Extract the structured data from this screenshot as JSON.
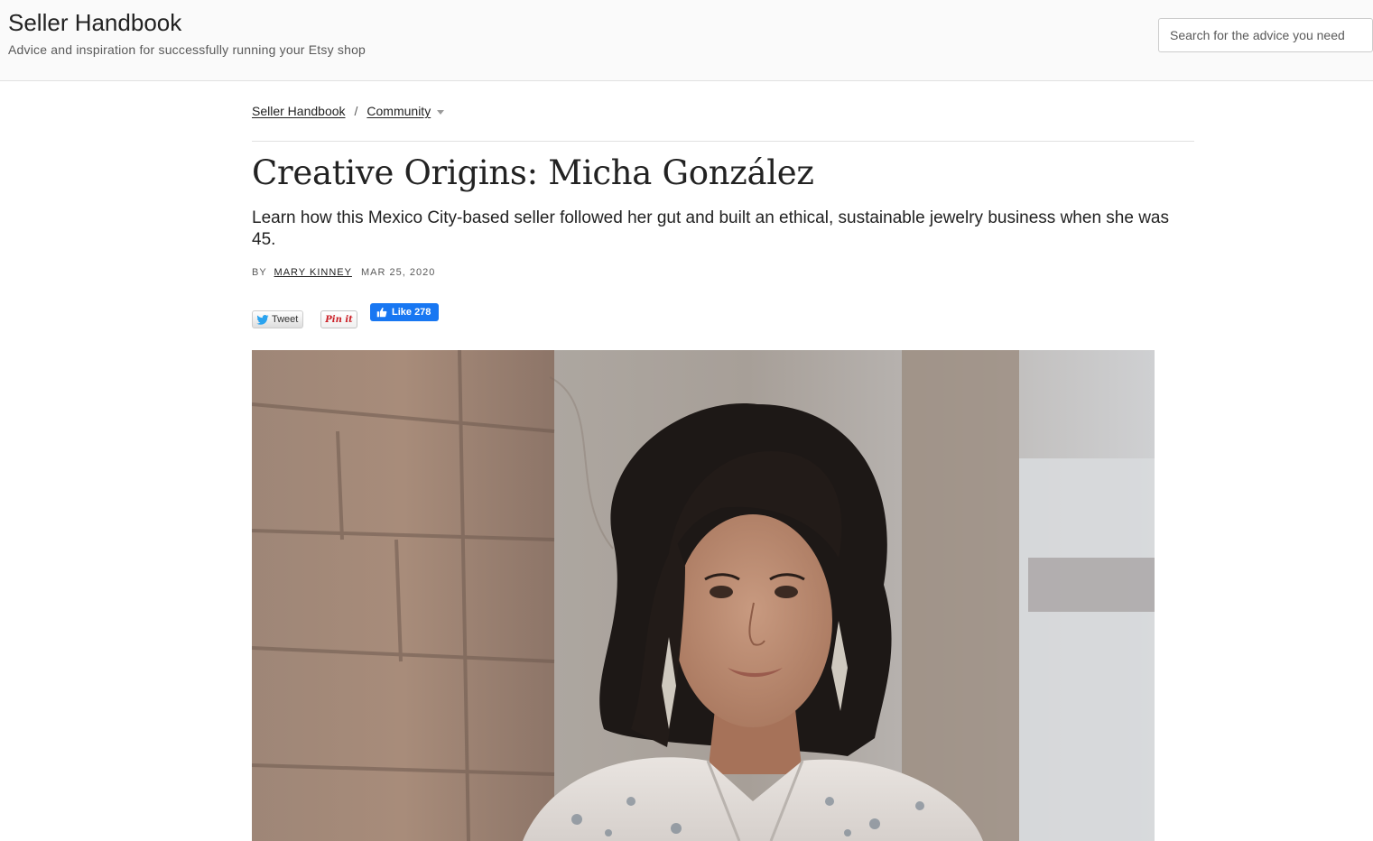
{
  "header": {
    "site_title": "Seller Handbook",
    "tagline": "Advice and inspiration for successfully running your Etsy shop",
    "search_placeholder": "Search for the advice you need"
  },
  "breadcrumb": {
    "items": [
      "Seller Handbook",
      "Community"
    ],
    "separator": "/"
  },
  "article": {
    "title": "Creative Origins: Micha González",
    "subtitle": "Learn how this Mexico City-based seller followed her gut and built an ethical, sustainable jewelry business when she was 45.",
    "byline_prefix": "BY",
    "author": "MARY KINNEY",
    "date": "MAR 25, 2020"
  },
  "social": {
    "tweet_label": "Tweet",
    "pin_label": "Pin it",
    "like_label": "Like 278",
    "like_color": "#1877f2",
    "pin_color": "#cb2027"
  },
  "hero_image": {
    "subject": "portrait-photo"
  }
}
